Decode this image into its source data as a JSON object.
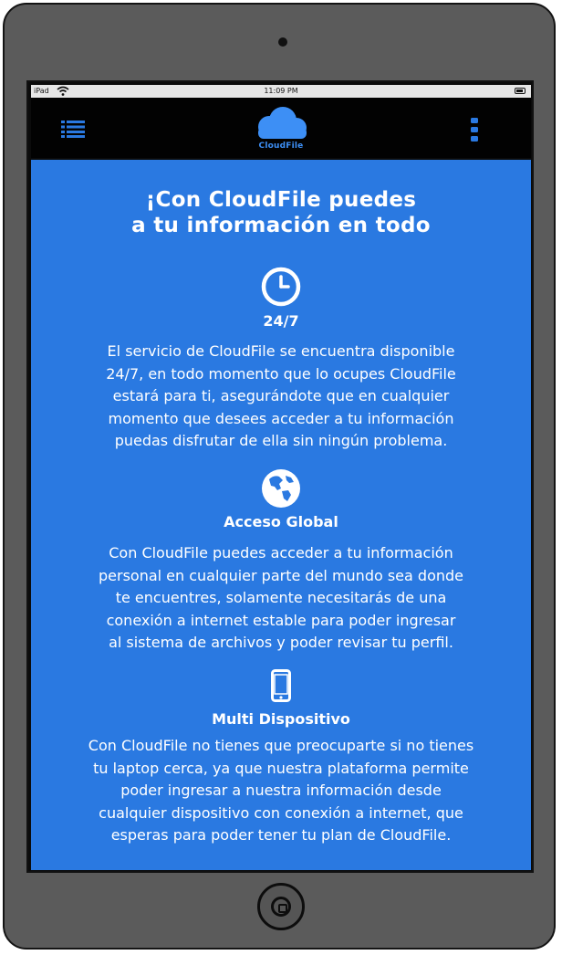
{
  "status_bar": {
    "carrier": "iPad",
    "time": "11:09 PM",
    "icons": [
      "wifi-icon",
      "battery-icon"
    ]
  },
  "navbar": {
    "logo_text": "CloudFile",
    "icons": [
      "menu-icon",
      "cloud-logo-icon",
      "more-vertical-icon"
    ]
  },
  "main": {
    "headline_line1": "¡Con CloudFile puedes",
    "headline_line2": "a tu información en todo",
    "sections": [
      {
        "icon": "clock-icon",
        "title": "24/7",
        "lines": [
          "El servicio de CloudFile se encuentra disponible",
          "24/7, en todo momento que lo ocupes CloudFile",
          "estará para ti, asegurándote que en cualquier",
          "momento que desees acceder a tu información",
          "puedas disfrutar de ella sin ningún problema."
        ]
      },
      {
        "icon": "globe-icon",
        "title": "Acceso Global",
        "lines": [
          "Con CloudFile puedes acceder a tu información",
          "personal en cualquier parte del mundo sea donde",
          "te encuentres, solamente necesitarás de una",
          "conexión a internet estable para poder ingresar",
          "al sistema de archivos y poder revisar tu perfil."
        ]
      },
      {
        "icon": "mobile-phone-icon",
        "title": "Multi Dispositivo",
        "lines": [
          "Con CloudFile no tienes que preocuparte si no tienes",
          "tu laptop cerca, ya que nuestra plataforma permite",
          "poder ingresar a nuestra información desde",
          "cualquier dispositivo con conexión a internet, que",
          "esperas para poder tener tu plan de CloudFile."
        ]
      }
    ]
  },
  "colors": {
    "content_background": "#2a79e1",
    "navbar_background": "#020202",
    "logo_accent": "#3d8ff5",
    "device_body": "#5b5b5b"
  }
}
